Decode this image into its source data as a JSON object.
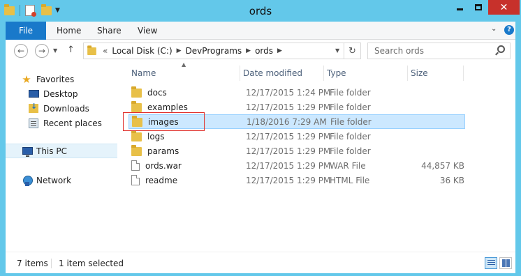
{
  "window": {
    "title": "ords"
  },
  "ribbon": {
    "tabs": [
      "File",
      "Home",
      "Share",
      "View"
    ]
  },
  "address": {
    "overflow": "«",
    "crumbs": [
      "Local Disk (C:)",
      "DevPrograms",
      "ords"
    ]
  },
  "search": {
    "placeholder": "Search ords"
  },
  "nav_pane": {
    "favorites": "Favorites",
    "desktop": "Desktop",
    "downloads": "Downloads",
    "recent": "Recent places",
    "this_pc": "This PC",
    "network": "Network"
  },
  "columns": {
    "name": "Name",
    "date": "Date modified",
    "type": "Type",
    "size": "Size"
  },
  "files": [
    {
      "name": "docs",
      "date": "12/17/2015 1:24 PM",
      "type": "File folder",
      "size": ""
    },
    {
      "name": "examples",
      "date": "12/17/2015 1:29 PM",
      "type": "File folder",
      "size": ""
    },
    {
      "name": "images",
      "date": "1/18/2016 7:29 AM",
      "type": "File folder",
      "size": ""
    },
    {
      "name": "logs",
      "date": "12/17/2015 1:29 PM",
      "type": "File folder",
      "size": ""
    },
    {
      "name": "params",
      "date": "12/17/2015 1:29 PM",
      "type": "File folder",
      "size": ""
    },
    {
      "name": "ords.war",
      "date": "12/17/2015 1:29 PM",
      "type": "WAR File",
      "size": "44,857 KB"
    },
    {
      "name": "readme",
      "date": "12/17/2015 1:29 PM",
      "type": "HTML File",
      "size": "36 KB"
    }
  ],
  "status": {
    "count": "7 items",
    "selected": "1 item selected"
  },
  "colors": {
    "titlebar": "#63c8ea",
    "file_tab": "#1979ca",
    "selection": "#cce8ff",
    "highlight": "#e0302c"
  },
  "icons": {
    "folder": "folder-icon",
    "file": "file-icon",
    "search": "search-icon"
  }
}
